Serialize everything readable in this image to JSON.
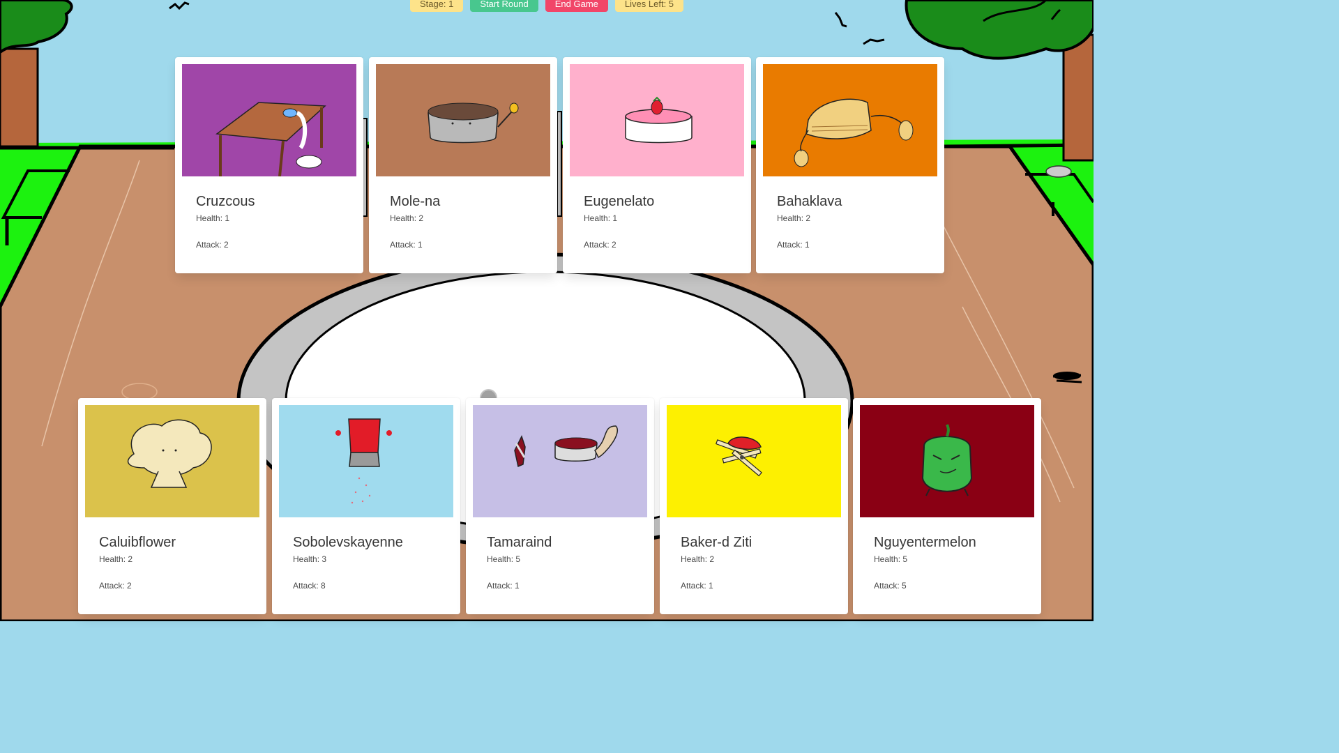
{
  "toolbar": {
    "stage_label": "Stage: 1",
    "start_label": "Start Round",
    "end_label": "End Game",
    "lives_label": "Lives Left: 5"
  },
  "colors": {
    "sky": "#9fd9ec",
    "grass": "#1cf20f",
    "wood": "#c8906c",
    "button_yellow": "#fde38a",
    "button_green": "#48c78e",
    "button_red": "#f14668"
  },
  "shop_cards": [
    {
      "name": "Cruzcous",
      "health": "Health: 1",
      "attack": "Attack: 2",
      "bg": "#a046a8",
      "icon": "table-couscous-icon"
    },
    {
      "name": "Mole-na",
      "health": "Health: 2",
      "attack": "Attack: 1",
      "bg": "#b87a57",
      "icon": "mole-pot-icon"
    },
    {
      "name": "Eugenelato",
      "health": "Health: 1",
      "attack": "Attack: 2",
      "bg": "#ffb0cc",
      "icon": "gelato-cake-icon"
    },
    {
      "name": "Bahaklava",
      "health": "Health: 2",
      "attack": "Attack: 1",
      "bg": "#e97b00",
      "icon": "baklava-icon"
    }
  ],
  "team_cards": [
    {
      "name": "Caluibflower",
      "health": "Health: 2",
      "attack": "Attack: 2",
      "bg": "#dbc24b",
      "icon": "cauliflower-icon"
    },
    {
      "name": "Sobolevskayenne",
      "health": "Health: 3",
      "attack": "Attack: 8",
      "bg": "#a0dbee",
      "icon": "cayenne-shaker-icon"
    },
    {
      "name": "Tamaraind",
      "health": "Health: 5",
      "attack": "Attack: 1",
      "bg": "#c6bfe6",
      "icon": "tamarind-icon"
    },
    {
      "name": "Baker-d Ziti",
      "health": "Health: 2",
      "attack": "Attack: 1",
      "bg": "#fdf001",
      "icon": "baked-ziti-icon"
    },
    {
      "name": "Nguyentermelon",
      "health": "Health: 5",
      "attack": "Attack: 5",
      "bg": "#8a0014",
      "icon": "wintermelon-icon"
    }
  ]
}
